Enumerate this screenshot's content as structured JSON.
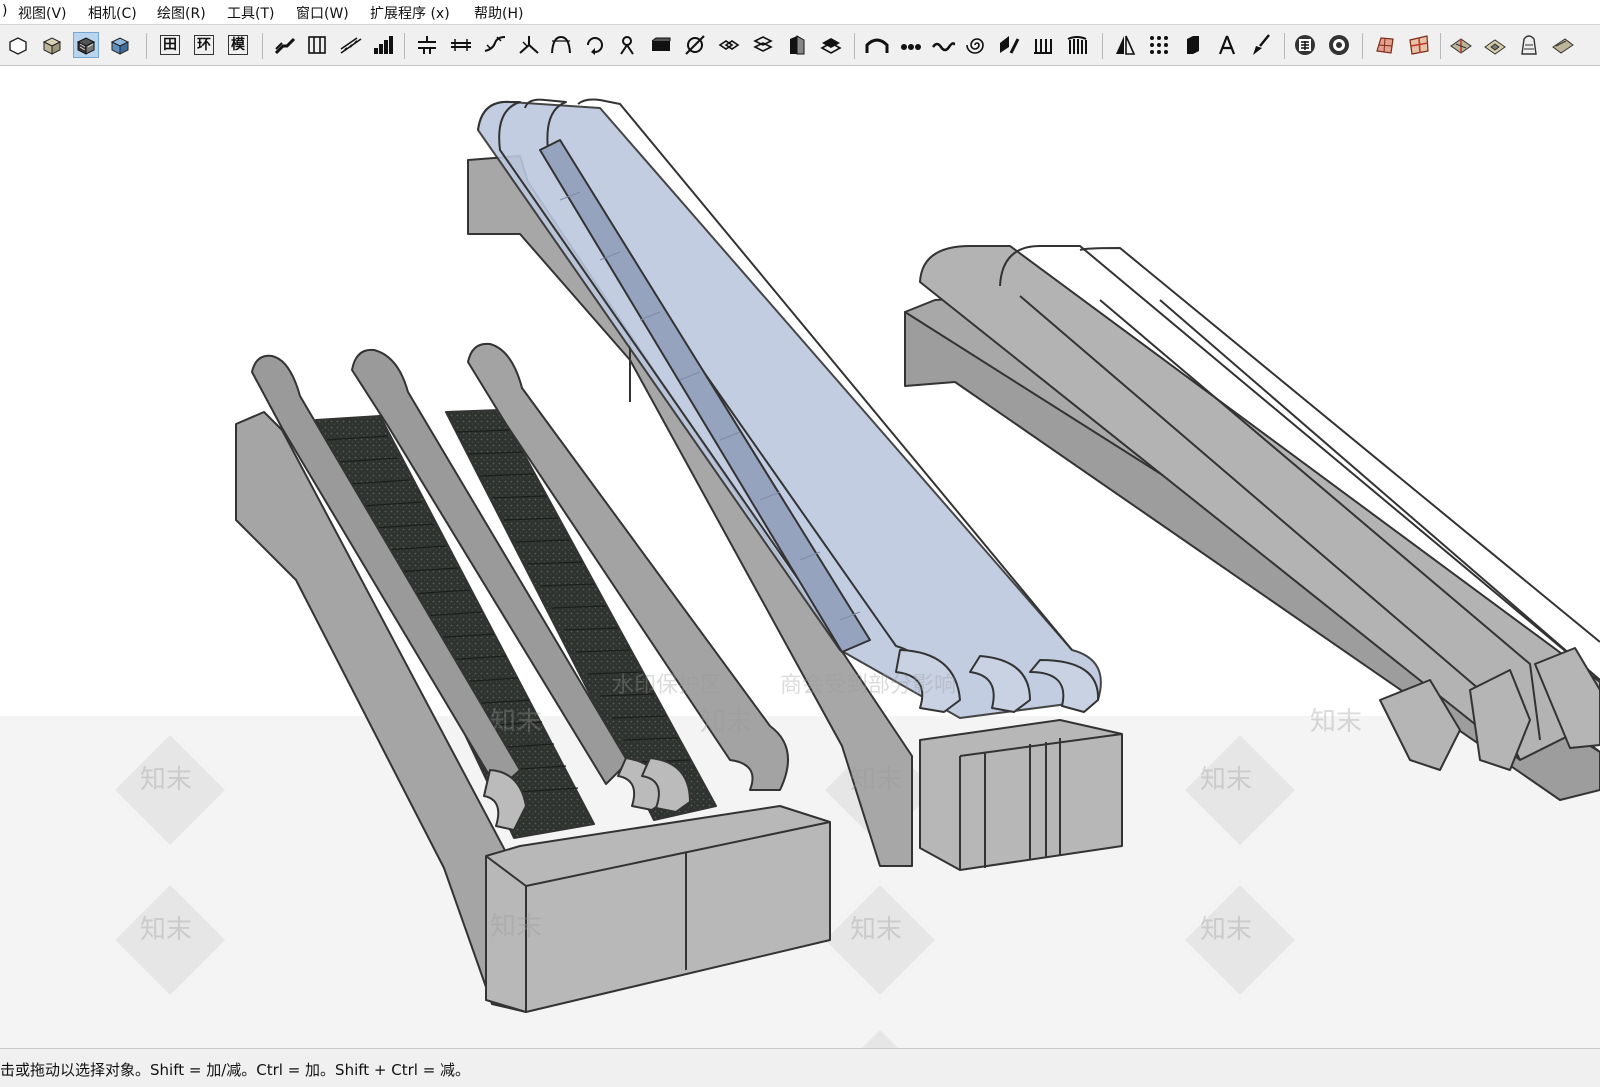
{
  "menu": {
    "items": [
      {
        "label": ")"
      },
      {
        "label": "视图(V)"
      },
      {
        "label": "相机(C)"
      },
      {
        "label": "绘图(R)"
      },
      {
        "label": "工具(T)"
      },
      {
        "label": "窗口(W)"
      },
      {
        "label": "扩展程序 (x)"
      },
      {
        "label": "帮助(H)"
      }
    ]
  },
  "toolbar": {
    "glyph_buttons": [
      {
        "icon": "grid-icon",
        "glyph": "田"
      },
      {
        "icon": "ring-icon",
        "glyph": "环"
      },
      {
        "icon": "model-icon",
        "glyph": "模"
      }
    ],
    "active_tool": "shaded-textured-style-icon"
  },
  "watermark": {
    "text": "水印保护区",
    "text2": "商会受到部分影响",
    "brand": "知末"
  },
  "status": {
    "text": "击或拖动以选择对象。Shift = 加/减。Ctrl = 加。Shift + Ctrl = 减。"
  }
}
